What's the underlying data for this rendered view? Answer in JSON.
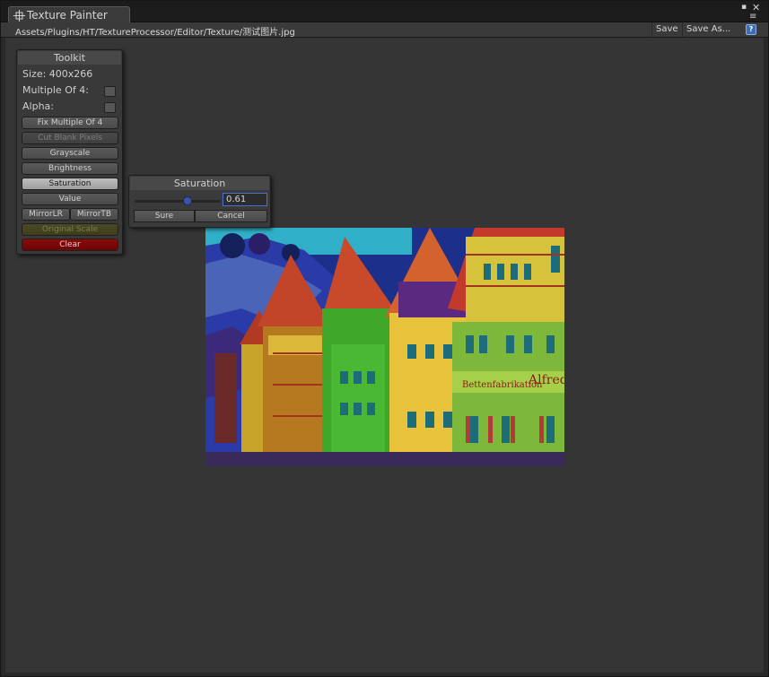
{
  "window": {
    "tab_title": "Texture Painter",
    "path": "Assets/Plugins/HT/TextureProcessor/Editor/Texture/测试图片.jpg",
    "save_label": "Save",
    "save_as_label": "Save As...",
    "help_icon": "help-book-icon",
    "tab_icon": "crosshair-move-icon",
    "close_icon": "close-icon",
    "maximize_icon": "maximize-icon",
    "menu_icon": "menu-icon"
  },
  "toolkit": {
    "title": "Toolkit",
    "size_text": "Size: 400x266",
    "multiple_of_4_label": "Multiple Of 4:",
    "multiple_of_4_checked": false,
    "alpha_label": "Alpha:",
    "alpha_checked": false,
    "buttons": {
      "fix_multiple": "Fix Multiple Of 4",
      "cut_blank": "Cut Blank Pixels",
      "grayscale": "Grayscale",
      "brightness": "Brightness",
      "saturation": "Saturation",
      "value": "Value",
      "mirror_lr": "MirrorLR",
      "mirror_tb": "MirrorTB",
      "original_scale": "Original Scale",
      "clear": "Clear"
    }
  },
  "saturation_popup": {
    "title": "Saturation",
    "value_text": "0.61",
    "slider_fraction": 0.61,
    "sure_label": "Sure",
    "cancel_label": "Cancel",
    "accent": "#4b6fd3"
  },
  "texture": {
    "description_icon": "edited-photo-half-timbered-houses"
  }
}
